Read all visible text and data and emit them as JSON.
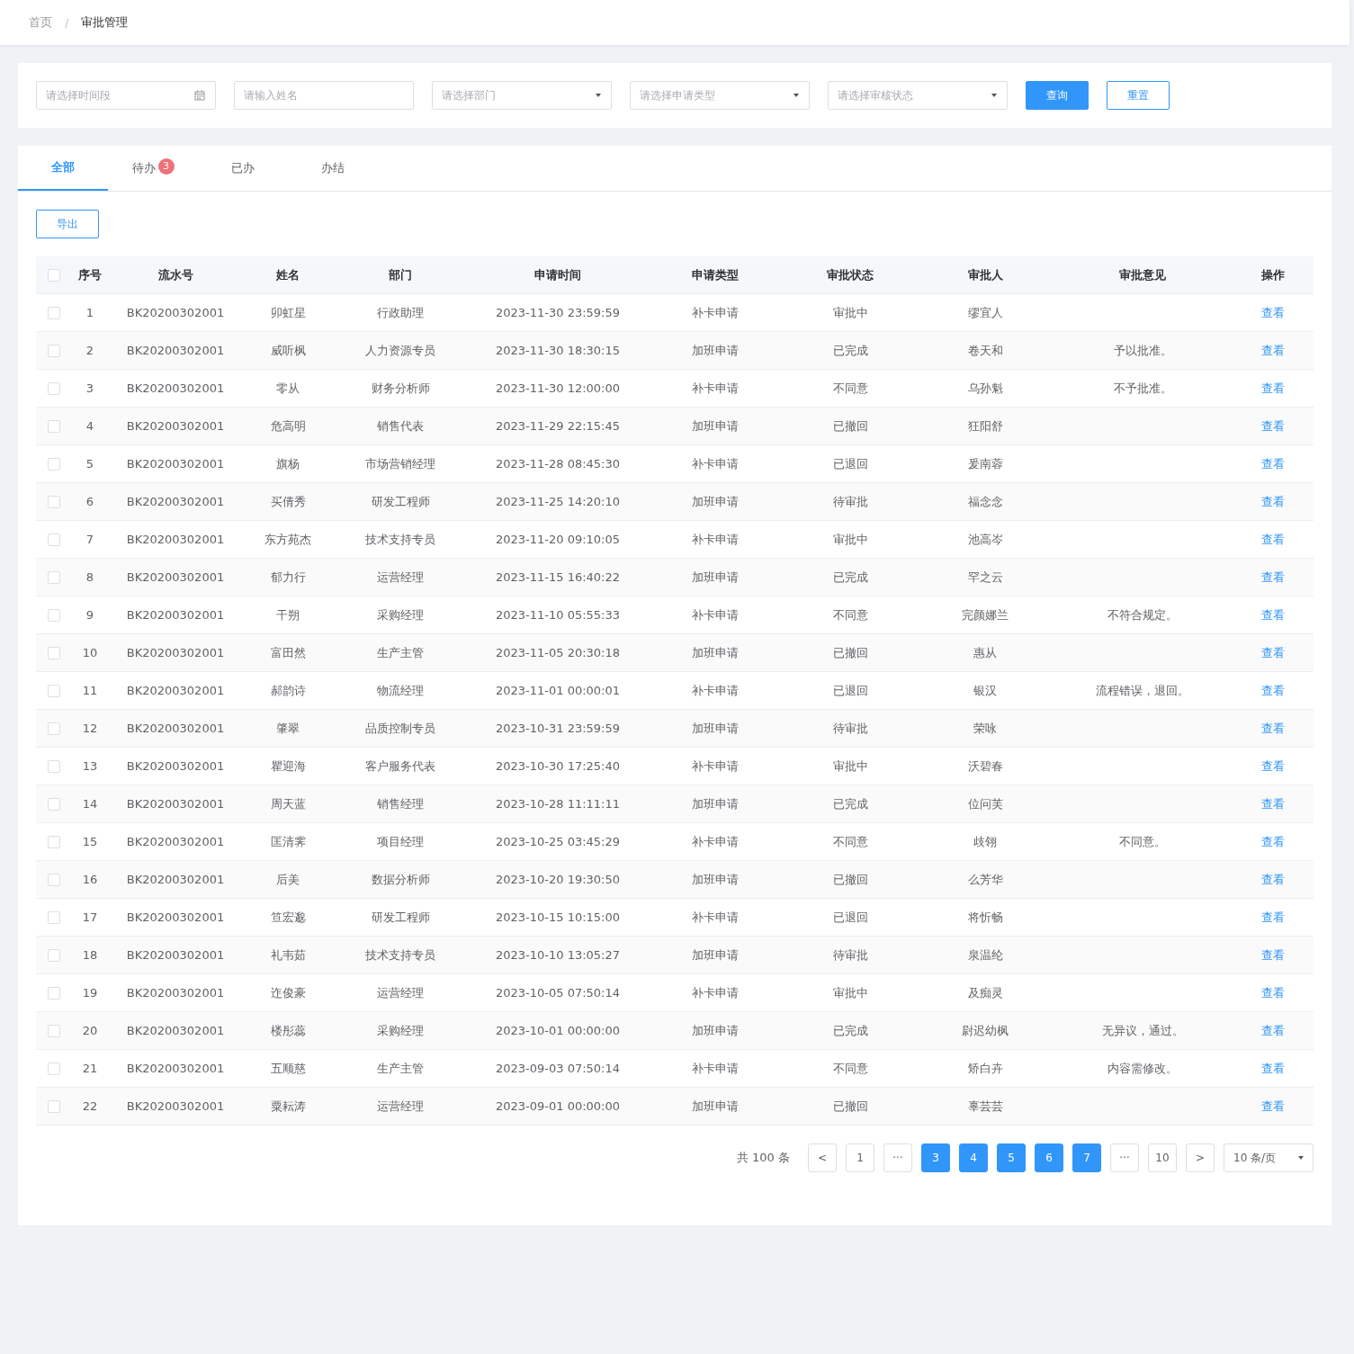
{
  "breadcrumb": [
    {
      "label": "首页",
      "current": false
    },
    {
      "label": "审批管理",
      "current": true
    }
  ],
  "breadcrumb_separator": "/",
  "filters": [
    {
      "kind": "date",
      "placeholder": "请选择时间段"
    },
    {
      "kind": "text",
      "placeholder": "请输入姓名"
    },
    {
      "kind": "select",
      "placeholder": "请选择部门"
    },
    {
      "kind": "select",
      "placeholder": "请选择申请类型"
    },
    {
      "kind": "select",
      "placeholder": "请选择审核状态"
    }
  ],
  "buttons": [
    {
      "kind": "primary",
      "label": "查询"
    },
    {
      "kind": "outline",
      "label": "重置"
    }
  ],
  "tabs": [
    {
      "label": "全部",
      "selected": true
    },
    {
      "label": "待办",
      "selected": false,
      "badge": "3"
    },
    {
      "label": "已办",
      "selected": false
    },
    {
      "label": "办结",
      "selected": false
    }
  ],
  "export_button": "导出",
  "table": {
    "select_all_checked": false,
    "columns": [
      "序号",
      "流水号",
      "姓名",
      "部门",
      "申请时间",
      "申请类型",
      "审批状态",
      "审批人",
      "审批意见",
      "操作"
    ],
    "rows": [
      {
        "checked": false,
        "no": "1",
        "serial": "BK20200302001",
        "name": "卯虹星",
        "dept": "行政助理",
        "time": "2023-11-30 23:59:59",
        "type": "补卡申请",
        "status": "审批中",
        "approver": "缪宜人",
        "action": "查看"
      },
      {
        "checked": false,
        "no": "2",
        "serial": "BK20200302001",
        "name": "威听枫",
        "dept": "人力资源专员",
        "time": "2023-11-30 18:30:15",
        "type": "加班申请",
        "status": "已完成",
        "approver": "卷天和",
        "opinion": "予以批准。",
        "action": "查看"
      },
      {
        "checked": false,
        "no": "3",
        "serial": "BK20200302001",
        "name": "零从",
        "dept": "财务分析师",
        "time": "2023-11-30 12:00:00",
        "type": "补卡申请",
        "status": "不同意",
        "approver": "乌孙魁",
        "opinion": "不予批准。",
        "action": "查看"
      },
      {
        "checked": false,
        "no": "4",
        "serial": "BK20200302001",
        "name": "危高明",
        "dept": "销售代表",
        "time": "2023-11-29 22:15:45",
        "type": "加班申请",
        "status": "已撤回",
        "approver": "狂阳舒",
        "action": "查看"
      },
      {
        "checked": false,
        "no": "5",
        "serial": "BK20200302001",
        "name": "旗杨",
        "dept": "市场营销经理",
        "time": "2023-11-28 08:45:30",
        "type": "补卡申请",
        "status": "已退回",
        "approver": "爰南蓉",
        "action": "查看"
      },
      {
        "checked": false,
        "no": "6",
        "serial": "BK20200302001",
        "name": "买倩秀",
        "dept": "研发工程师",
        "time": "2023-11-25 14:20:10",
        "type": "加班申请",
        "status": "待审批",
        "approver": "福念念",
        "action": "查看"
      },
      {
        "checked": false,
        "no": "7",
        "serial": "BK20200302001",
        "name": "东方苑杰",
        "dept": "技术支持专员",
        "time": "2023-11-20 09:10:05",
        "type": "补卡申请",
        "status": "审批中",
        "approver": "池高岑",
        "action": "查看"
      },
      {
        "checked": false,
        "no": "8",
        "serial": "BK20200302001",
        "name": "郁力行",
        "dept": "运营经理",
        "time": "2023-11-15 16:40:22",
        "type": "加班申请",
        "status": "已完成",
        "approver": "罕之云",
        "action": "查看"
      },
      {
        "checked": false,
        "no": "9",
        "serial": "BK20200302001",
        "name": "干朔",
        "dept": "采购经理",
        "time": "2023-11-10 05:55:33",
        "type": "补卡申请",
        "status": "不同意",
        "approver": "完颜娜兰",
        "opinion": "不符合规定。",
        "action": "查看"
      },
      {
        "checked": false,
        "no": "10",
        "serial": "BK20200302001",
        "name": "富田然",
        "dept": "生产主管",
        "time": "2023-11-05 20:30:18",
        "type": "加班申请",
        "status": "已撤回",
        "approver": "惠从",
        "action": "查看"
      },
      {
        "checked": false,
        "no": "11",
        "serial": "BK20200302001",
        "name": "郝韵诗",
        "dept": "物流经理",
        "time": "2023-11-01 00:00:01",
        "type": "补卡申请",
        "status": "已退回",
        "approver": "银汉",
        "opinion": "流程错误，退回。",
        "action": "查看"
      },
      {
        "checked": false,
        "no": "12",
        "serial": "BK20200302001",
        "name": "肇翠",
        "dept": "品质控制专员",
        "time": "2023-10-31 23:59:59",
        "type": "加班申请",
        "status": "待审批",
        "approver": "荣咏",
        "action": "查看"
      },
      {
        "checked": false,
        "no": "13",
        "serial": "BK20200302001",
        "name": "瞿迎海",
        "dept": "客户服务代表",
        "time": "2023-10-30 17:25:40",
        "type": "补卡申请",
        "status": "审批中",
        "approver": "沃碧春",
        "action": "查看"
      },
      {
        "checked": false,
        "no": "14",
        "serial": "BK20200302001",
        "name": "周天蓝",
        "dept": "销售经理",
        "time": "2023-10-28 11:11:11",
        "type": "加班申请",
        "status": "已完成",
        "approver": "位问芙",
        "action": "查看"
      },
      {
        "checked": false,
        "no": "15",
        "serial": "BK20200302001",
        "name": "匡清霁",
        "dept": "项目经理",
        "time": "2023-10-25 03:45:29",
        "type": "补卡申请",
        "status": "不同意",
        "approver": "歧翎",
        "opinion": "不同意。",
        "action": "查看"
      },
      {
        "checked": false,
        "no": "16",
        "serial": "BK20200302001",
        "name": "后美",
        "dept": "数据分析师",
        "time": "2023-10-20 19:30:50",
        "type": "加班申请",
        "status": "已撤回",
        "approver": "么芳华",
        "action": "查看"
      },
      {
        "checked": false,
        "no": "17",
        "serial": "BK20200302001",
        "name": "笪宏邈",
        "dept": "研发工程师",
        "time": "2023-10-15 10:15:00",
        "type": "补卡申请",
        "status": "已退回",
        "approver": "将忻畅",
        "action": "查看"
      },
      {
        "checked": false,
        "no": "18",
        "serial": "BK20200302001",
        "name": "礼韦茹",
        "dept": "技术支持专员",
        "time": "2023-10-10 13:05:27",
        "type": "加班申请",
        "status": "待审批",
        "approver": "泉温纶",
        "action": "查看"
      },
      {
        "checked": false,
        "no": "19",
        "serial": "BK20200302001",
        "name": "迮俊豪",
        "dept": "运营经理",
        "time": "2023-10-05 07:50:14",
        "type": "补卡申请",
        "status": "审批中",
        "approver": "及痴灵",
        "action": "查看"
      },
      {
        "checked": false,
        "no": "20",
        "serial": "BK20200302001",
        "name": "楼彤蕊",
        "dept": "采购经理",
        "time": "2023-10-01 00:00:00",
        "type": "加班申请",
        "status": "已完成",
        "approver": "尉迟幼枫",
        "opinion": "无异议，通过。",
        "action": "查看"
      },
      {
        "checked": false,
        "no": "21",
        "serial": "BK20200302001",
        "name": "五顺慈",
        "dept": "生产主管",
        "time": "2023-09-03 07:50:14",
        "type": "补卡申请",
        "status": "不同意",
        "approver": "矫白卉",
        "opinion": "内容需修改。",
        "action": "查看"
      },
      {
        "checked": false,
        "no": "22",
        "serial": "BK20200302001",
        "name": "粟耘涛",
        "dept": "运营经理",
        "time": "2023-09-01 00:00:00",
        "type": "加班申请",
        "status": "已撤回",
        "approver": "辜芸芸",
        "action": "查看"
      }
    ]
  },
  "pagination": {
    "total": "共 100 条",
    "items": [
      {
        "kind": "prev",
        "label": "<"
      },
      {
        "kind": "page",
        "label": "1",
        "selected": false
      },
      {
        "kind": "more",
        "label": "···"
      },
      {
        "kind": "page",
        "label": "3",
        "selected": true
      },
      {
        "kind": "page",
        "label": "4",
        "selected": true
      },
      {
        "kind": "page",
        "label": "5",
        "selected": true
      },
      {
        "kind": "page",
        "label": "6",
        "selected": true
      },
      {
        "kind": "page",
        "label": "7",
        "selected": true
      },
      {
        "kind": "more",
        "label": "···"
      },
      {
        "kind": "page",
        "label": "10",
        "selected": false
      },
      {
        "kind": "next",
        "label": ">"
      }
    ],
    "page_size": "10 条/页"
  }
}
